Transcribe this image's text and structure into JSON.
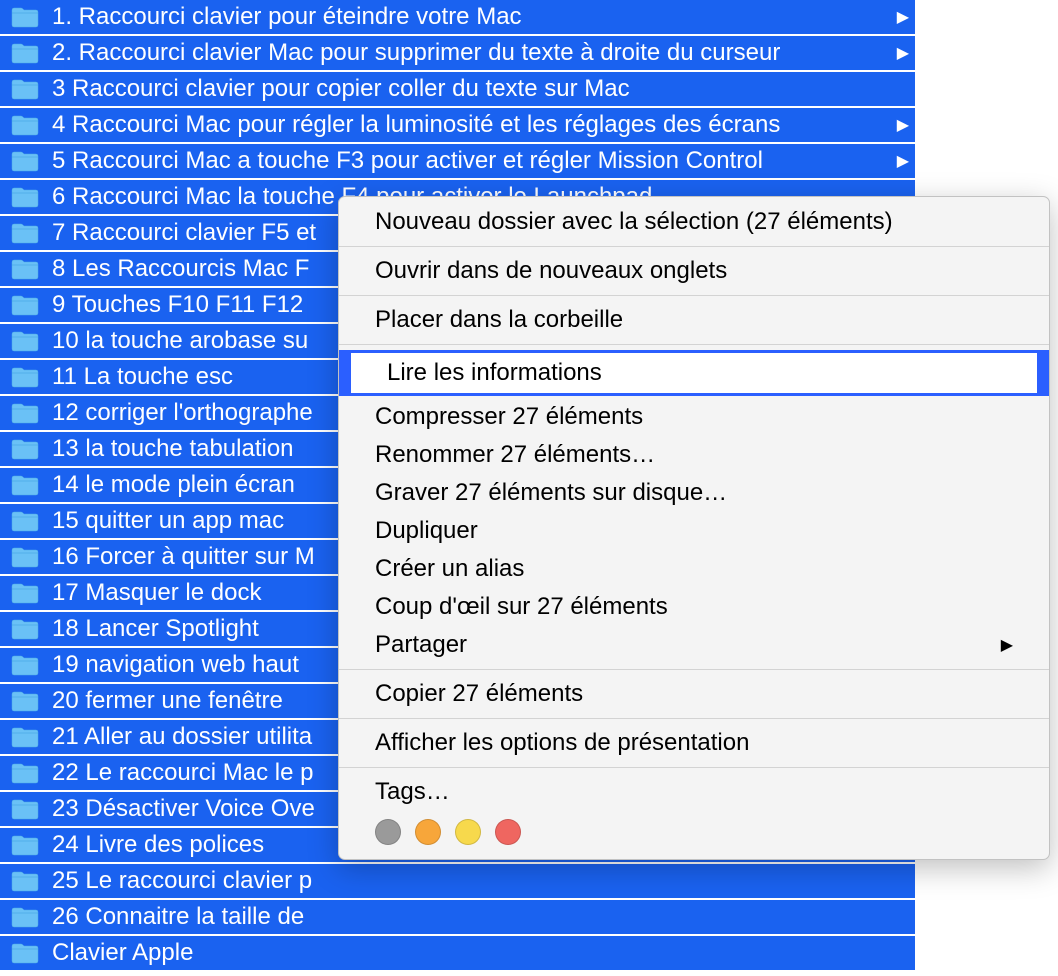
{
  "list": {
    "items": [
      {
        "label": "1. Raccourci clavier pour éteindre votre Mac",
        "has_children": true
      },
      {
        "label": "2. Raccourci clavier Mac pour supprimer du texte à droite du curseur",
        "has_children": true
      },
      {
        "label": "3 Raccourci clavier pour copier coller du texte sur Mac",
        "has_children": false
      },
      {
        "label": "4 Raccourci Mac pour régler la luminosité et les réglages des écrans",
        "has_children": true
      },
      {
        "label": "5 Raccourci Mac a touche F3 pour activer et régler Mission Control",
        "has_children": true
      },
      {
        "label": "6 Raccourci Mac la touche F4 pour activer le Launchpad",
        "has_children": false
      },
      {
        "label": "7 Raccourci clavier F5 et",
        "has_children": false
      },
      {
        "label": "8 Les Raccourcis Mac F",
        "has_children": false
      },
      {
        "label": "9 Touches F10 F11 F12 ",
        "has_children": false
      },
      {
        "label": "10 la touche arobase su",
        "has_children": false
      },
      {
        "label": "11 La touche esc",
        "has_children": false
      },
      {
        "label": "12 corriger l'orthographe",
        "has_children": false
      },
      {
        "label": "13 la touche tabulation",
        "has_children": false
      },
      {
        "label": "14 le mode plein écran",
        "has_children": false
      },
      {
        "label": "15 quitter un app mac",
        "has_children": false
      },
      {
        "label": "16 Forcer à quitter sur M",
        "has_children": false
      },
      {
        "label": "17 Masquer le dock",
        "has_children": false
      },
      {
        "label": "18 Lancer Spotlight",
        "has_children": false
      },
      {
        "label": "19 navigation web haut ",
        "has_children": false
      },
      {
        "label": "20 fermer une fenêtre",
        "has_children": false
      },
      {
        "label": "21 Aller au dossier utilita",
        "has_children": false
      },
      {
        "label": "22 Le raccourci Mac le p",
        "has_children": false
      },
      {
        "label": "23 Désactiver Voice Ove",
        "has_children": false
      },
      {
        "label": "24 Livre des polices",
        "has_children": false
      },
      {
        "label": "25 Le raccourci clavier p",
        "has_children": false
      },
      {
        "label": "26 Connaitre la taille de ",
        "has_children": false
      },
      {
        "label": "Clavier Apple",
        "has_children": false
      }
    ]
  },
  "context_menu": {
    "groups": [
      [
        {
          "label": "Nouveau dossier avec la sélection (27 éléments)",
          "submenu": false,
          "highlighted": false
        }
      ],
      [
        {
          "label": "Ouvrir dans de nouveaux onglets",
          "submenu": false,
          "highlighted": false
        }
      ],
      [
        {
          "label": "Placer dans la corbeille",
          "submenu": false,
          "highlighted": false
        }
      ],
      [
        {
          "label": "Lire les informations",
          "submenu": false,
          "highlighted": true
        },
        {
          "label": "Compresser 27 éléments",
          "submenu": false,
          "highlighted": false
        },
        {
          "label": "Renommer 27 éléments…",
          "submenu": false,
          "highlighted": false
        },
        {
          "label": "Graver 27 éléments sur disque…",
          "submenu": false,
          "highlighted": false
        },
        {
          "label": "Dupliquer",
          "submenu": false,
          "highlighted": false
        },
        {
          "label": "Créer un alias",
          "submenu": false,
          "highlighted": false
        },
        {
          "label": "Coup d'œil sur 27 éléments",
          "submenu": false,
          "highlighted": false
        },
        {
          "label": "Partager",
          "submenu": true,
          "highlighted": false
        }
      ],
      [
        {
          "label": "Copier 27 éléments",
          "submenu": false,
          "highlighted": false
        }
      ],
      [
        {
          "label": "Afficher les options de présentation",
          "submenu": false,
          "highlighted": false
        }
      ],
      [
        {
          "label": "Tags…",
          "submenu": false,
          "highlighted": false
        }
      ]
    ],
    "tags": {
      "colors": [
        "#9a9a9a",
        "#f7a63a",
        "#f7d94c",
        "#ef6660"
      ]
    }
  }
}
